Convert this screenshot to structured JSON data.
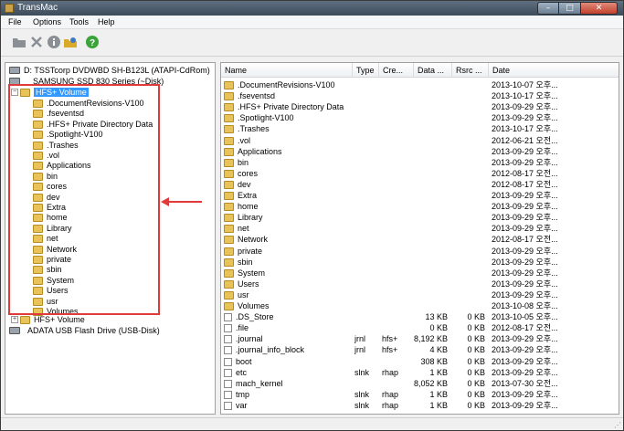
{
  "window": {
    "title": "TransMac",
    "min_glyph": "–",
    "max_glyph": "□",
    "close_glyph": "✕"
  },
  "menu": [
    "File",
    "Options",
    "Tools",
    "Help"
  ],
  "toolbar": [
    "folder-icon",
    "delete-icon",
    "info-icon",
    "explore-icon",
    "help-icon"
  ],
  "tree": {
    "drives": [
      {
        "label": "D: TSSTcorp DVDWBD SH-B123L (ATAPI-CdRom)",
        "icon": "cdrom-icon"
      },
      {
        "label": "SAMSUNG SSD 830 Series (~Disk)",
        "icon": "hard-disk-icon"
      },
      {
        "label": "HFS+ Volume",
        "icon": "folder-icon",
        "selected": true
      },
      {
        "label": "HFS+ Volume",
        "icon": "folder-icon"
      },
      {
        "label": "ADATA USB Flash Drive (USB-Disk)",
        "icon": "usb-drive-icon"
      }
    ],
    "children": [
      ".DocumentRevisions-V100",
      ".fseventsd",
      ".HFS+ Private Directory Data",
      ".Spotlight-V100",
      ".Trashes",
      ".vol",
      "Applications",
      "bin",
      "cores",
      "dev",
      "Extra",
      "home",
      "Library",
      "net",
      "Network",
      "private",
      "sbin",
      "System",
      "Users",
      "usr",
      "Volumes"
    ]
  },
  "list": {
    "columns": [
      "Name",
      "Type",
      "Cre...",
      "Data ...",
      "Rsrc ...",
      "Date"
    ],
    "rows": [
      {
        "name": ".DocumentRevisions-V100",
        "kind": "folder",
        "type": "",
        "creator": "",
        "data": "",
        "rsrc": "",
        "date": "2013-10-07 오후..."
      },
      {
        "name": ".fseventsd",
        "kind": "folder",
        "type": "",
        "creator": "",
        "data": "",
        "rsrc": "",
        "date": "2013-10-17 오후..."
      },
      {
        "name": ".HFS+ Private Directory Data",
        "kind": "folder",
        "type": "",
        "creator": "",
        "data": "",
        "rsrc": "",
        "date": "2013-09-29 오후..."
      },
      {
        "name": ".Spotlight-V100",
        "kind": "folder",
        "type": "",
        "creator": "",
        "data": "",
        "rsrc": "",
        "date": "2013-09-29 오후..."
      },
      {
        "name": ".Trashes",
        "kind": "folder",
        "type": "",
        "creator": "",
        "data": "",
        "rsrc": "",
        "date": "2013-10-17 오후..."
      },
      {
        "name": ".vol",
        "kind": "folder",
        "type": "",
        "creator": "",
        "data": "",
        "rsrc": "",
        "date": "2012-06-21 오전..."
      },
      {
        "name": "Applications",
        "kind": "folder",
        "type": "",
        "creator": "",
        "data": "",
        "rsrc": "",
        "date": "2013-09-29 오후..."
      },
      {
        "name": "bin",
        "kind": "folder",
        "type": "",
        "creator": "",
        "data": "",
        "rsrc": "",
        "date": "2013-09-29 오후..."
      },
      {
        "name": "cores",
        "kind": "folder",
        "type": "",
        "creator": "",
        "data": "",
        "rsrc": "",
        "date": "2012-08-17 오전..."
      },
      {
        "name": "dev",
        "kind": "folder",
        "type": "",
        "creator": "",
        "data": "",
        "rsrc": "",
        "date": "2012-08-17 오전..."
      },
      {
        "name": "Extra",
        "kind": "folder",
        "type": "",
        "creator": "",
        "data": "",
        "rsrc": "",
        "date": "2013-09-29 오후..."
      },
      {
        "name": "home",
        "kind": "folder",
        "type": "",
        "creator": "",
        "data": "",
        "rsrc": "",
        "date": "2013-09-29 오후..."
      },
      {
        "name": "Library",
        "kind": "folder",
        "type": "",
        "creator": "",
        "data": "",
        "rsrc": "",
        "date": "2013-09-29 오후..."
      },
      {
        "name": "net",
        "kind": "folder",
        "type": "",
        "creator": "",
        "data": "",
        "rsrc": "",
        "date": "2013-09-29 오후..."
      },
      {
        "name": "Network",
        "kind": "folder",
        "type": "",
        "creator": "",
        "data": "",
        "rsrc": "",
        "date": "2012-08-17 오전..."
      },
      {
        "name": "private",
        "kind": "folder",
        "type": "",
        "creator": "",
        "data": "",
        "rsrc": "",
        "date": "2013-09-29 오후..."
      },
      {
        "name": "sbin",
        "kind": "folder",
        "type": "",
        "creator": "",
        "data": "",
        "rsrc": "",
        "date": "2013-09-29 오후..."
      },
      {
        "name": "System",
        "kind": "folder",
        "type": "",
        "creator": "",
        "data": "",
        "rsrc": "",
        "date": "2013-09-29 오후..."
      },
      {
        "name": "Users",
        "kind": "folder",
        "type": "",
        "creator": "",
        "data": "",
        "rsrc": "",
        "date": "2013-09-29 오후..."
      },
      {
        "name": "usr",
        "kind": "folder",
        "type": "",
        "creator": "",
        "data": "",
        "rsrc": "",
        "date": "2013-09-29 오후..."
      },
      {
        "name": "Volumes",
        "kind": "folder",
        "type": "",
        "creator": "",
        "data": "",
        "rsrc": "",
        "date": "2013-10-08 오후..."
      },
      {
        "name": ".DS_Store",
        "kind": "file",
        "type": "",
        "creator": "",
        "data": "13 KB",
        "rsrc": "0 KB",
        "date": "2013-10-05 오후..."
      },
      {
        "name": ".file",
        "kind": "file",
        "type": "",
        "creator": "",
        "data": "0 KB",
        "rsrc": "0 KB",
        "date": "2012-08-17 오전..."
      },
      {
        "name": ".journal",
        "kind": "file",
        "type": "jrnl",
        "creator": "hfs+",
        "data": "8,192 KB",
        "rsrc": "0 KB",
        "date": "2013-09-29 오후..."
      },
      {
        "name": ".journal_info_block",
        "kind": "file",
        "type": "jrnl",
        "creator": "hfs+",
        "data": "4 KB",
        "rsrc": "0 KB",
        "date": "2013-09-29 오후..."
      },
      {
        "name": "boot",
        "kind": "file",
        "type": "",
        "creator": "",
        "data": "308 KB",
        "rsrc": "0 KB",
        "date": "2013-09-29 오후..."
      },
      {
        "name": "etc",
        "kind": "file",
        "type": "slnk",
        "creator": "rhap",
        "data": "1 KB",
        "rsrc": "0 KB",
        "date": "2013-09-29 오후..."
      },
      {
        "name": "mach_kernel",
        "kind": "file",
        "type": "",
        "creator": "",
        "data": "8,052 KB",
        "rsrc": "0 KB",
        "date": "2013-07-30 오전..."
      },
      {
        "name": "tmp",
        "kind": "file",
        "type": "slnk",
        "creator": "rhap",
        "data": "1 KB",
        "rsrc": "0 KB",
        "date": "2013-09-29 오후..."
      },
      {
        "name": "var",
        "kind": "file",
        "type": "slnk",
        "creator": "rhap",
        "data": "1 KB",
        "rsrc": "0 KB",
        "date": "2013-09-29 오후..."
      }
    ]
  },
  "colors": {
    "annotation": "#e03a3a",
    "selection": "#3399ff",
    "folder": "#e8c35a"
  }
}
